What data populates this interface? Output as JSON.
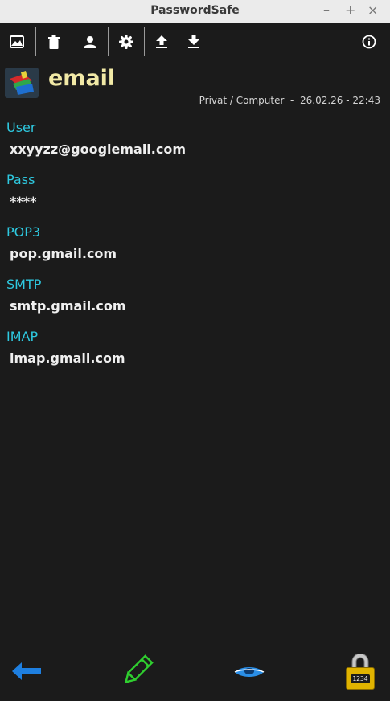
{
  "window": {
    "title": "PasswordSafe",
    "controls": [
      "–",
      "+",
      "×"
    ]
  },
  "toolbar": {
    "icons": [
      "image-icon",
      "trash-icon",
      "user-icon",
      "gear-icon",
      "upload-icon",
      "download-icon",
      "info-icon"
    ]
  },
  "entry": {
    "title": "email",
    "meta": "Privat / Computer  -  26.02.26 - 22:43"
  },
  "fields": [
    {
      "label": "User",
      "value": "xxyyzz@googlemail.com"
    },
    {
      "label": "Pass",
      "value": "****"
    },
    {
      "label": "POP3",
      "value": "pop.gmail.com"
    },
    {
      "label": "SMTP",
      "value": "smtp.gmail.com"
    },
    {
      "label": "IMAP",
      "value": "imap.gmail.com"
    }
  ],
  "bottom_bar": {
    "lock_code": "1234",
    "colors": {
      "back": "#1e7fe0",
      "edit": "#2fcf2f",
      "eye": "#2a8fe8",
      "lock": "#e0b300"
    }
  }
}
